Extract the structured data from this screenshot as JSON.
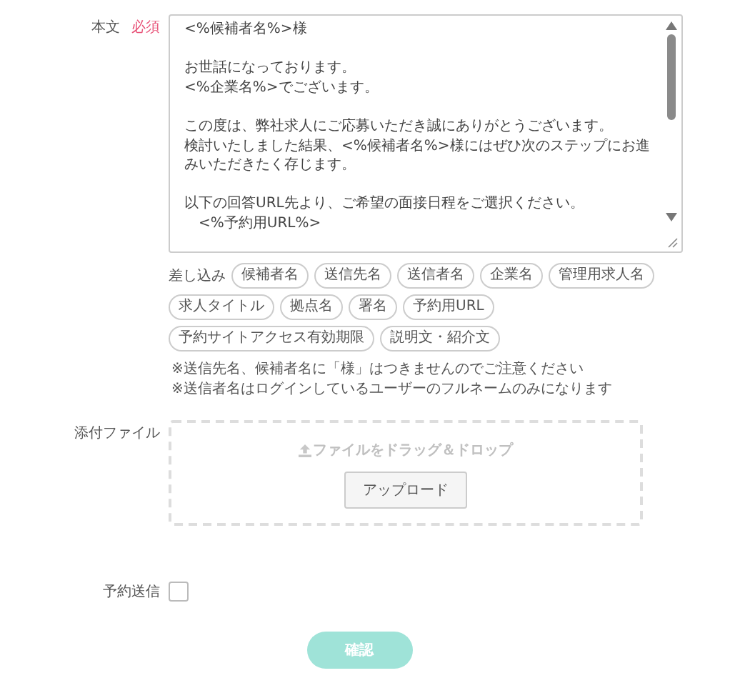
{
  "body": {
    "label": "本文",
    "required_badge": "必須",
    "paragraphs": [
      [
        "<%候補者名%>様"
      ],
      [
        "お世話になっております。",
        "<%企業名%>でございます。"
      ],
      [
        "この度は、弊社求人にご応募いただき誠にありがとうございます。",
        "検討いたしました結果、<%候補者名%>様にはぜひ次のステップにお進みいただきたく存じます。"
      ],
      [
        "以下の回答URL先より、ご希望の面接日程をご選択ください。",
        "　<%予約用URL%>"
      ]
    ]
  },
  "insert": {
    "label": "差し込み",
    "tags": [
      "候補者名",
      "送信先名",
      "送信者名",
      "企業名",
      "管理用求人名",
      "求人タイトル",
      "拠点名",
      "署名",
      "予約用URL",
      "予約サイトアクセス有効期限",
      "説明文・紹介文"
    ]
  },
  "notes": [
    "※送信先名、候補者名に「様」はつきませんのでご注意ください",
    "※送信者名はログインしているユーザーのフルネームのみになります"
  ],
  "attachment": {
    "label": "添付ファイル",
    "drop_hint": "ファイルをドラッグ＆ドロップ",
    "upload_button": "アップロード"
  },
  "scheduled_send": {
    "label": "予約送信",
    "checked": false
  },
  "confirm_button": {
    "label": "確認",
    "disabled": true
  }
}
